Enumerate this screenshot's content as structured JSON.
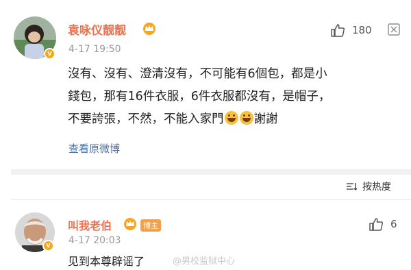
{
  "comment1": {
    "username": "袁咏仪靓靓",
    "time": "4-17 19:50",
    "likes": "180",
    "text_lines": [
      "沒有、沒有、澄清沒有，不可能有6個包，都是小",
      "錢包，那有16件衣服，6件衣服都沒有，是帽子，",
      "不要誇張，不然，不能入家門"
    ],
    "text_suffix": "謝謝",
    "view_original": "查看原微博"
  },
  "sort": {
    "label": "按热度"
  },
  "comment2": {
    "username": "叫我老伯",
    "badge": "博主",
    "time": "4-17 20:03",
    "likes": "6",
    "text": "见到本尊辟谣了"
  },
  "watermark": "@男校监狱中心",
  "colors": {
    "username": "#eb7350",
    "link": "#4a6fa5",
    "badge": "#f3a04a"
  }
}
